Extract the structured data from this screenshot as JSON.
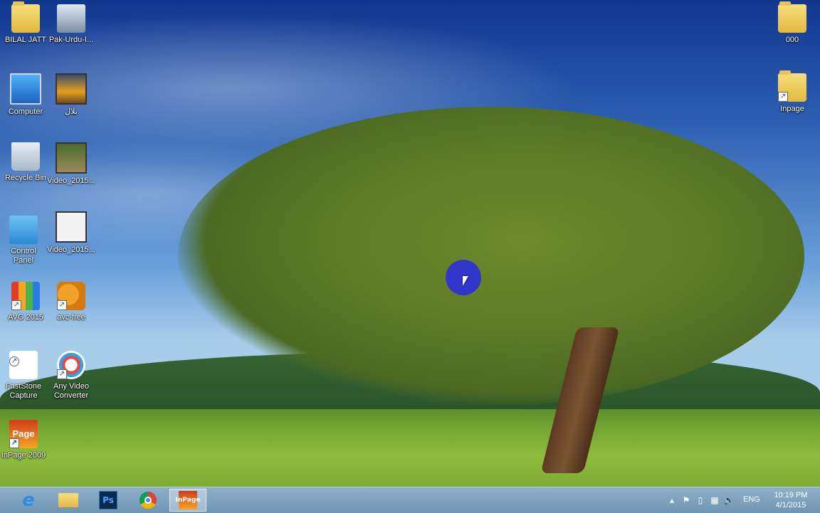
{
  "desktop": {
    "left_icons": [
      {
        "label": "BILAL JATT",
        "icon": "user-folder-icon"
      },
      {
        "label": "Computer",
        "icon": "computer-icon"
      },
      {
        "label": "Recycle Bin",
        "icon": "recycle-bin-icon"
      },
      {
        "label": "Control Panel",
        "icon": "control-panel-icon"
      },
      {
        "label": "AVG 2015",
        "icon": "avg-icon"
      },
      {
        "label": "FastStone Capture",
        "icon": "faststone-capture-icon"
      },
      {
        "label": "InPage 2009",
        "icon": "inpage-icon"
      }
    ],
    "second_column_icons": [
      {
        "label": "Pak-Urdu-I...",
        "icon": "installer-icon"
      },
      {
        "label": "بلال",
        "icon": "video-file-icon"
      },
      {
        "label": "Video_2015...",
        "icon": "video-file-icon"
      },
      {
        "label": "Video_2015...",
        "icon": "video-file-icon"
      },
      {
        "label": "avc-free",
        "icon": "avc-free-icon"
      },
      {
        "label": "Any Video Converter",
        "icon": "any-video-converter-icon"
      }
    ],
    "right_icons": [
      {
        "label": "000",
        "icon": "folder-icon"
      },
      {
        "label": "Inpage",
        "icon": "folder-shortcut-icon"
      }
    ],
    "inpage_icon_text": "Page"
  },
  "taskbar": {
    "pinned": [
      {
        "name": "Internet Explorer",
        "icon": "internet-explorer-icon"
      },
      {
        "name": "File Explorer",
        "icon": "file-explorer-icon"
      },
      {
        "name": "Photoshop",
        "icon": "photoshop-icon",
        "glyph": "Ps"
      },
      {
        "name": "Google Chrome",
        "icon": "chrome-icon"
      },
      {
        "name": "InPage",
        "icon": "inpage-taskbar-icon",
        "glyph": "InPage",
        "active": true
      }
    ],
    "tray": {
      "language": "ENG",
      "time": "10:19 PM",
      "date": "4/1/2015"
    }
  }
}
